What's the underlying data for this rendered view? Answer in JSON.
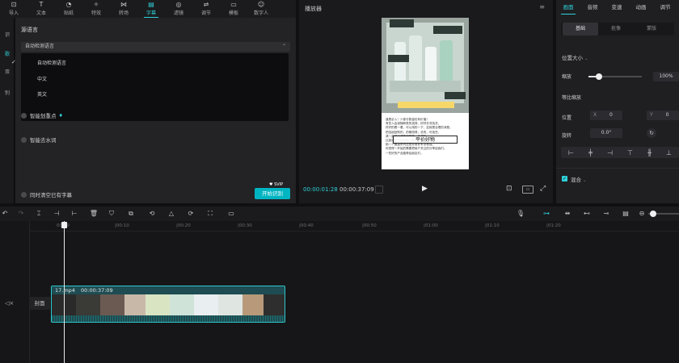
{
  "toolbar": {
    "items": [
      {
        "label": "导入",
        "icon": "import-icon"
      },
      {
        "label": "文本",
        "icon": "text-icon"
      },
      {
        "label": "贴纸",
        "icon": "sticker-icon"
      },
      {
        "label": "特效",
        "icon": "effects-icon"
      },
      {
        "label": "转场",
        "icon": "transition-icon"
      },
      {
        "label": "字幕",
        "icon": "caption-icon",
        "active": true
      },
      {
        "label": "滤镜",
        "icon": "filter-icon"
      },
      {
        "label": "调节",
        "icon": "adjust-icon"
      },
      {
        "label": "模板",
        "icon": "template-icon"
      },
      {
        "label": "数字人",
        "icon": "digital-human-icon"
      }
    ]
  },
  "left_column": {
    "items": [
      "识",
      "歌",
      "双",
      "别"
    ]
  },
  "captions": {
    "source_language_title": "源语言",
    "selected_language": "自动检测语言",
    "dropdown_options": [
      "自动检测语言",
      "中文",
      "英文"
    ],
    "checked_option": "自动检测语言",
    "smart_key_points": "智能划重点",
    "smart_filler_removal": "智能去水词",
    "clear_existing": "同时清空已有字幕",
    "vip_label": "♥ SVIP",
    "start_button": "开始识别"
  },
  "player": {
    "title": "播放器",
    "current_time": "00:00:01:28",
    "total_time": "00:00:37:09",
    "video_caption_lines": [
      "逢是必入！少部分数量也有价值！",
      "有些人会追随种类的选择，好好去寻找关，",
      "好好的看一看，可以用的一下，这就是合理的消费。",
      "把这组回购的，的确觉得，总的，可信任，",
      "请一定做个调查研究的一手资料。",
      "比如说全方位的这三款产品表达的",
      "她一个面霜系列还是非常补水非常强。",
      "你觉得一开始的需要把用户关注的分享给我们。",
      "一些好的产品推荐给朋友们。"
    ],
    "overlay_text": "平价好物"
  },
  "right_panel": {
    "tabs": [
      "画面",
      "音频",
      "变速",
      "动画",
      "调节"
    ],
    "active_tab": "画面",
    "sub_tabs": [
      "基础",
      "抠像",
      "蒙版"
    ],
    "position_size": "位置大小",
    "scale_label": "缩放",
    "scale_value": "100%",
    "scale_fraction": 0.2,
    "uniform_scale": "等比缩放",
    "position_label": "位置",
    "x_label": "X",
    "x_value": "0",
    "y_label": "Y",
    "y_value": "0",
    "rotate_label": "旋转",
    "rotate_value": "0.0°",
    "blend_label": "混合"
  },
  "timeline": {
    "ruler": [
      "00:00",
      "|00:10",
      "|00:20",
      "|00:30",
      "|00:40",
      "|00:50",
      "|01:00",
      "|01:10",
      "|01:20"
    ],
    "cover_label": "封面",
    "clip_name": "17.mp4",
    "clip_duration": "00:00:37:09"
  }
}
